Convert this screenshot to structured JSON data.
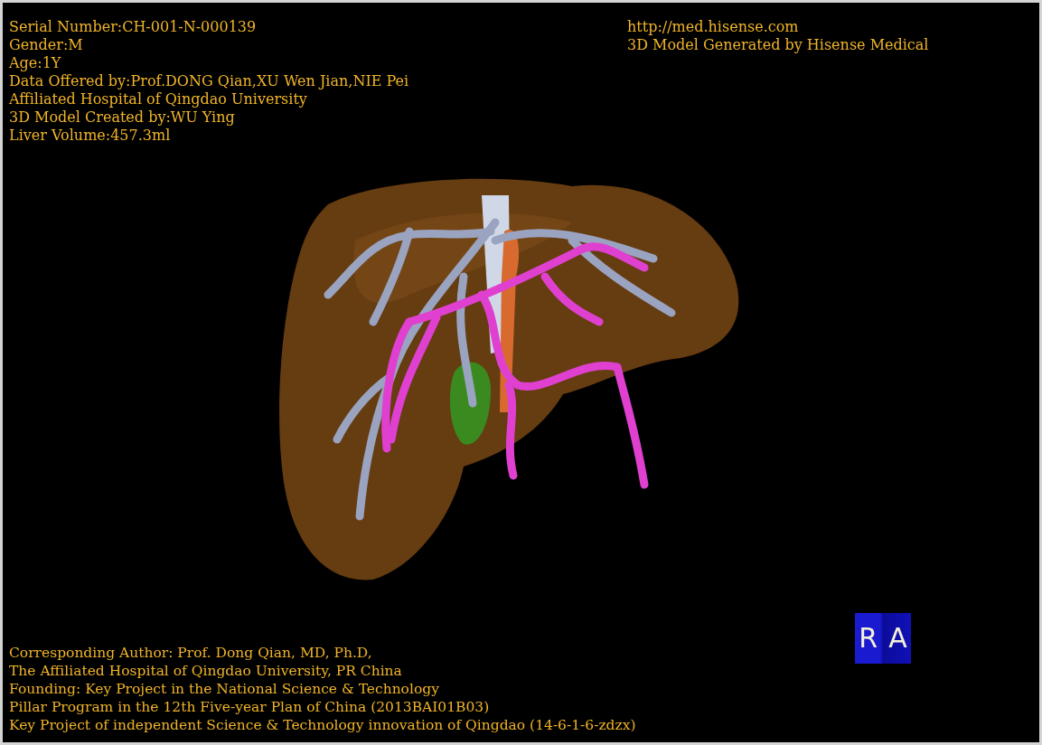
{
  "info_left": [
    "Serial Number:CH-001-N-000139",
    "Gender:M",
    "Age:1Y",
    "Data Offered by:Prof.DONG Qian,XU Wen Jian,NIE Pei",
    "Affiliated Hospital of Qingdao University",
    "3D Model Created by:WU Ying",
    "Liver Volume:457.3ml"
  ],
  "info_right": [
    "http://med.hisense.com",
    "3D Model Generated by Hisense Medical"
  ],
  "credits": [
    "Corresponding Author: Prof. Dong Qian, MD, Ph.D,",
    "The Affiliated Hospital of Qingdao University, PR China",
    "Founding: Key Project in the National Science & Technology",
    "Pillar Program in the 12th Five-year Plan of China (2013BAI01B03)",
    "Key Project of independent Science & Technology innovation of Qingdao (14-6-1-6-zdzx)"
  ],
  "orientation_cube": {
    "labels": [
      "R",
      "A"
    ]
  }
}
